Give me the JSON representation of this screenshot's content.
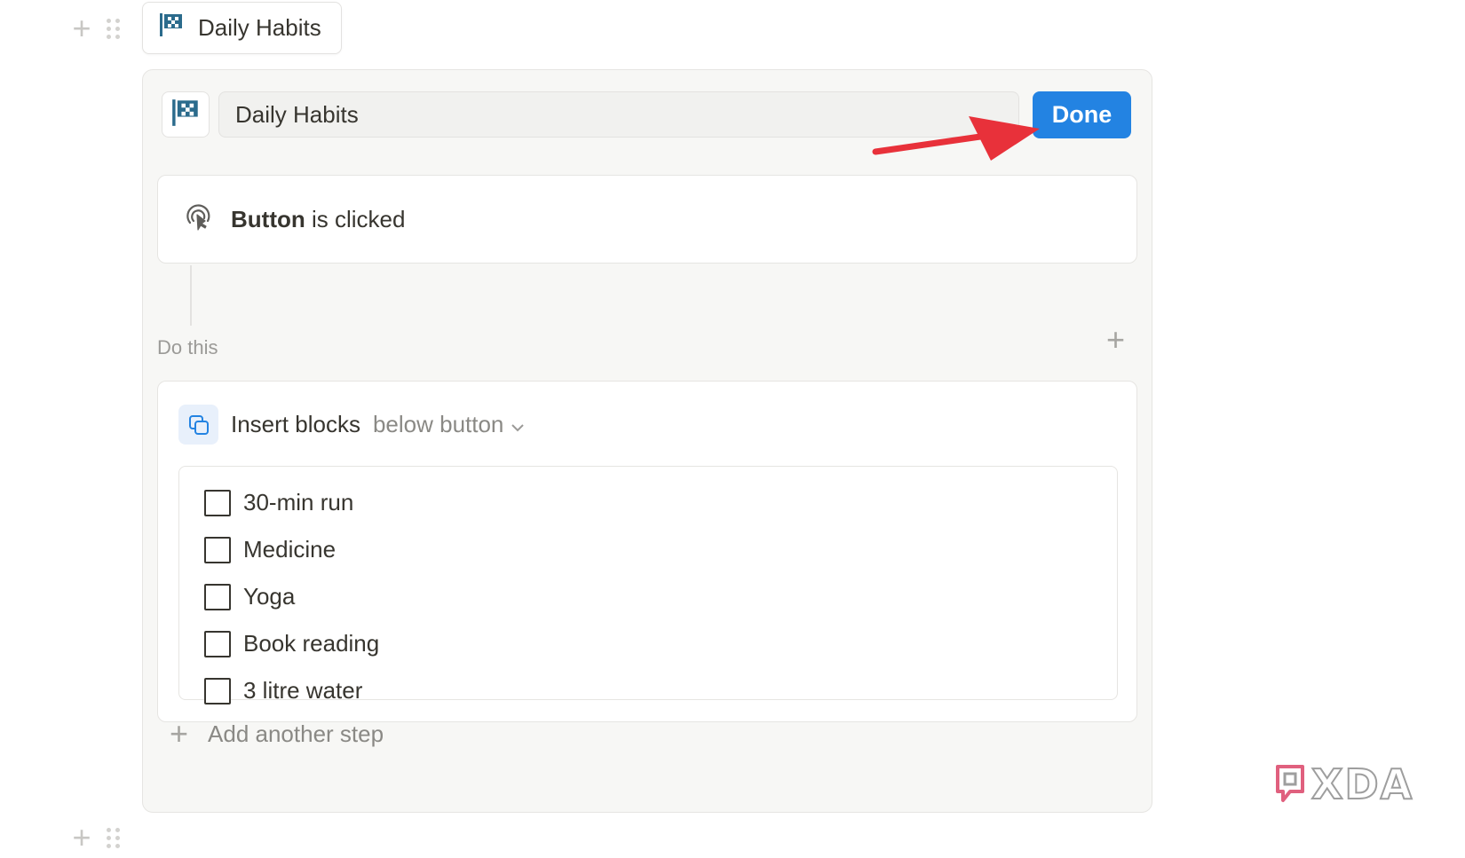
{
  "page_button": {
    "label": "Daily Habits",
    "icon": "checkered-flag-icon"
  },
  "editor": {
    "name_value": "Daily Habits",
    "done_label": "Done",
    "accent_color": "#2383e2",
    "annotation_arrow_color": "#e8313a"
  },
  "trigger": {
    "bold": "Button",
    "rest": " is clicked",
    "icon": "cursor-click-icon"
  },
  "actions": {
    "section_label": "Do this",
    "insert_title": "Insert blocks",
    "insert_target": "below button",
    "todos": [
      {
        "label": "30-min run",
        "checked": false
      },
      {
        "label": "Medicine",
        "checked": false
      },
      {
        "label": "Yoga",
        "checked": false
      },
      {
        "label": "Book reading",
        "checked": false
      },
      {
        "label": "3 litre water",
        "checked": false
      }
    ]
  },
  "add_step_label": "Add another step",
  "watermark": "XDA"
}
